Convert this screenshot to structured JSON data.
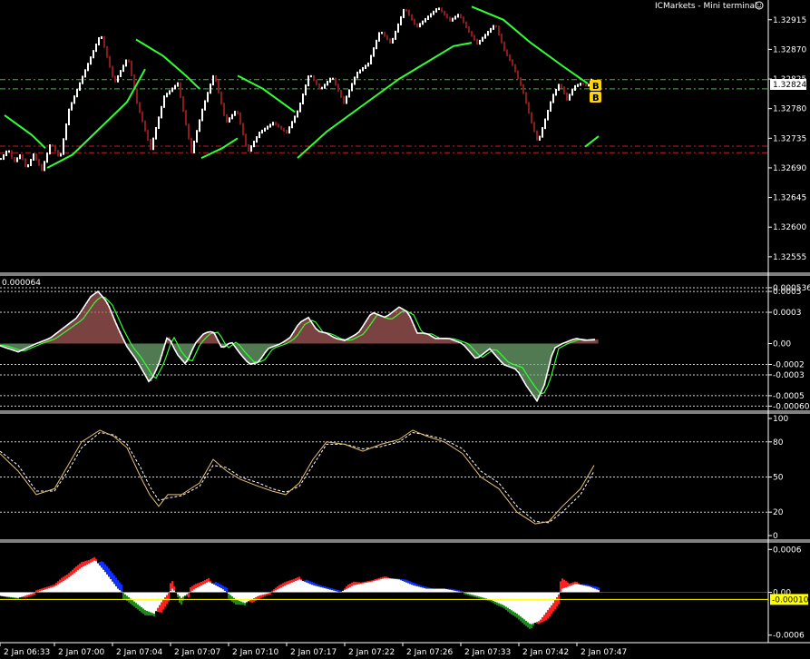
{
  "header": {
    "broker_label": "ICMarkets - Mini terminal",
    "icon": "smiley-icon"
  },
  "colors": {
    "background": "#000000",
    "grid": "#ffffff",
    "candle_up": "#ffffff",
    "candle_down": "#8b1a1a",
    "ma": "#32ff32",
    "level_green": "#2ec52e",
    "level_red": "#c02020",
    "badge": "#ffd700",
    "histogram_up": "#8b1a1a",
    "histogram_down": "#3a8a3a",
    "stoch_main": "#e8c070",
    "stoch_signal": "#ffffff",
    "p4_white": "#ffffff",
    "p4_red": "#ff2020",
    "p4_blue": "#1030ff",
    "p4_green": "#1a8a1a",
    "p4_line": "#ffff00"
  },
  "chart_data": [
    {
      "type": "line",
      "name": "price",
      "ylim": [
        1.3253,
        1.32945
      ],
      "yticks": [
        "1.32915",
        "1.32870",
        "1.32825",
        "1.32780",
        "1.32735",
        "1.32690",
        "1.32645",
        "1.32600",
        "1.32555"
      ],
      "current_price_label": "1.32824",
      "badges": [
        "B",
        "B"
      ],
      "levels": [
        {
          "value": 1.32824,
          "style": "dash-dot",
          "color": "level_green"
        },
        {
          "value": 1.3281,
          "style": "dash-dot",
          "color": "level_green"
        },
        {
          "value": 1.32723,
          "style": "dash-dot",
          "color": "level_red"
        },
        {
          "value": 1.32713,
          "style": "dash-dot",
          "color": "level_red"
        }
      ],
      "price_path": [
        [
          0,
          1.32705
        ],
        [
          8,
          1.3272
        ],
        [
          14,
          1.327
        ],
        [
          22,
          1.32712
        ],
        [
          28,
          1.3269
        ],
        [
          36,
          1.32712
        ],
        [
          45,
          1.32688
        ],
        [
          55,
          1.3273
        ],
        [
          65,
          1.32705
        ],
        [
          75,
          1.3278
        ],
        [
          90,
          1.3283
        ],
        [
          110,
          1.32895
        ],
        [
          125,
          1.3282
        ],
        [
          140,
          1.3286
        ],
        [
          150,
          1.3279
        ],
        [
          165,
          1.3272
        ],
        [
          180,
          1.328
        ],
        [
          195,
          1.3282
        ],
        [
          210,
          1.32715
        ],
        [
          222,
          1.3278
        ],
        [
          235,
          1.32835
        ],
        [
          248,
          1.3276
        ],
        [
          260,
          1.3278
        ],
        [
          272,
          1.32715
        ],
        [
          285,
          1.32745
        ],
        [
          300,
          1.3276
        ],
        [
          315,
          1.32745
        ],
        [
          328,
          1.3278
        ],
        [
          340,
          1.32835
        ],
        [
          352,
          1.3281
        ],
        [
          365,
          1.3283
        ],
        [
          378,
          1.3279
        ],
        [
          392,
          1.32835
        ],
        [
          405,
          1.3285
        ],
        [
          418,
          1.329
        ],
        [
          430,
          1.3288
        ],
        [
          445,
          1.32935
        ],
        [
          458,
          1.32905
        ],
        [
          470,
          1.3292
        ],
        [
          482,
          1.32935
        ],
        [
          495,
          1.32915
        ],
        [
          505,
          1.32925
        ],
        [
          515,
          1.329
        ],
        [
          525,
          1.3288
        ],
        [
          535,
          1.32895
        ],
        [
          545,
          1.3291
        ],
        [
          555,
          1.3287
        ],
        [
          565,
          1.32845
        ],
        [
          575,
          1.3281
        ],
        [
          585,
          1.3276
        ],
        [
          592,
          1.3273
        ],
        [
          600,
          1.32765
        ],
        [
          608,
          1.328
        ],
        [
          616,
          1.3282
        ],
        [
          624,
          1.32795
        ],
        [
          632,
          1.32815
        ],
        [
          640,
          1.3282
        ],
        [
          647,
          1.32815
        ],
        [
          652,
          1.32828
        ]
      ],
      "ma_segments": [
        [
          [
            5,
            1.3277
          ],
          [
            35,
            1.3274
          ],
          [
            50,
            1.3272
          ]
        ],
        [
          [
            52,
            1.3269
          ],
          [
            80,
            1.3271
          ],
          [
            110,
            1.3275
          ],
          [
            140,
            1.3279
          ],
          [
            160,
            1.3284
          ]
        ],
        [
          [
            150,
            1.32885
          ],
          [
            180,
            1.3286
          ],
          [
            205,
            1.3283
          ],
          [
            220,
            1.3281
          ]
        ],
        [
          [
            222,
            1.32705
          ],
          [
            245,
            1.3272
          ],
          [
            262,
            1.32735
          ]
        ],
        [
          [
            262,
            1.3283
          ],
          [
            290,
            1.3281
          ],
          [
            325,
            1.32775
          ]
        ],
        [
          [
            328,
            1.32705
          ],
          [
            360,
            1.32745
          ],
          [
            400,
            1.32785
          ],
          [
            440,
            1.32825
          ],
          [
            470,
            1.3285
          ],
          [
            500,
            1.32875
          ],
          [
            520,
            1.3288
          ]
        ],
        [
          [
            520,
            1.32935
          ],
          [
            555,
            1.32915
          ],
          [
            585,
            1.3288
          ],
          [
            620,
            1.32845
          ],
          [
            648,
            1.32818
          ]
        ],
        [
          [
            645,
            1.32722
          ],
          [
            660,
            1.32738
          ]
        ]
      ]
    },
    {
      "type": "bar",
      "name": "histogram_oscillator",
      "header_value": "0.000064",
      "ylim": [
        -0.00064,
        0.00064
      ],
      "yticks": [
        "0.000536",
        "0.0005",
        "0.0003",
        "0.00",
        "-0.0002",
        "-0.0003",
        "-0.0005",
        "-0.00060"
      ],
      "profile": [
        [
          0,
          -2e-05
        ],
        [
          20,
          -8e-05
        ],
        [
          40,
          0.0
        ],
        [
          55,
          5e-05
        ],
        [
          70,
          0.00015
        ],
        [
          85,
          0.00025
        ],
        [
          100,
          0.00045
        ],
        [
          108,
          0.0005
        ],
        [
          118,
          0.0004
        ],
        [
          130,
          0.00015
        ],
        [
          140,
          -3e-05
        ],
        [
          150,
          -0.00015
        ],
        [
          160,
          -0.0003
        ],
        [
          165,
          -0.00038
        ],
        [
          175,
          -0.0002
        ],
        [
          185,
          8e-05
        ],
        [
          195,
          -0.0001
        ],
        [
          205,
          -0.0002
        ],
        [
          215,
          0.0
        ],
        [
          225,
          0.0001
        ],
        [
          235,
          0.00012
        ],
        [
          245,
          -5e-05
        ],
        [
          255,
          2e-05
        ],
        [
          265,
          -0.0001
        ],
        [
          275,
          -0.0002
        ],
        [
          285,
          -0.00018
        ],
        [
          295,
          -5e-05
        ],
        [
          310,
          0.0
        ],
        [
          320,
          6e-05
        ],
        [
          330,
          0.0002
        ],
        [
          340,
          0.00025
        ],
        [
          350,
          0.00012
        ],
        [
          360,
          0.0001
        ],
        [
          370,
          5e-05
        ],
        [
          380,
          3e-05
        ],
        [
          395,
          0.0001
        ],
        [
          410,
          0.0003
        ],
        [
          425,
          0.00025
        ],
        [
          440,
          0.00035
        ],
        [
          450,
          0.0003
        ],
        [
          460,
          0.0001
        ],
        [
          470,
          0.0001
        ],
        [
          480,
          5e-05
        ],
        [
          495,
          5e-05
        ],
        [
          510,
          0.0
        ],
        [
          525,
          -0.00015
        ],
        [
          540,
          -5e-05
        ],
        [
          555,
          -0.0002
        ],
        [
          570,
          -0.00025
        ],
        [
          580,
          -0.0004
        ],
        [
          592,
          -0.00055
        ],
        [
          600,
          -0.0004
        ],
        [
          610,
          -5e-05
        ],
        [
          620,
          0.0
        ],
        [
          635,
          5e-05
        ],
        [
          645,
          3e-05
        ],
        [
          655,
          4e-05
        ]
      ]
    },
    {
      "type": "line",
      "name": "stochastic",
      "ylim": [
        0,
        100
      ],
      "yticks": [
        "100",
        "80",
        "50",
        "20",
        "0"
      ],
      "levels": [
        80,
        50,
        20
      ],
      "main": [
        [
          0,
          70
        ],
        [
          20,
          55
        ],
        [
          40,
          35
        ],
        [
          60,
          40
        ],
        [
          75,
          60
        ],
        [
          90,
          80
        ],
        [
          110,
          90
        ],
        [
          125,
          85
        ],
        [
          140,
          75
        ],
        [
          155,
          50
        ],
        [
          165,
          35
        ],
        [
          175,
          25
        ],
        [
          185,
          35
        ],
        [
          200,
          35
        ],
        [
          220,
          45
        ],
        [
          235,
          65
        ],
        [
          250,
          55
        ],
        [
          265,
          48
        ],
        [
          285,
          42
        ],
        [
          300,
          38
        ],
        [
          315,
          35
        ],
        [
          330,
          45
        ],
        [
          345,
          65
        ],
        [
          360,
          80
        ],
        [
          380,
          78
        ],
        [
          400,
          72
        ],
        [
          420,
          78
        ],
        [
          440,
          82
        ],
        [
          455,
          90
        ],
        [
          470,
          85
        ],
        [
          490,
          80
        ],
        [
          510,
          70
        ],
        [
          530,
          50
        ],
        [
          550,
          40
        ],
        [
          570,
          20
        ],
        [
          590,
          10
        ],
        [
          605,
          12
        ],
        [
          620,
          25
        ],
        [
          640,
          40
        ],
        [
          655,
          60
        ]
      ],
      "signal": [
        [
          0,
          72
        ],
        [
          20,
          60
        ],
        [
          40,
          38
        ],
        [
          60,
          38
        ],
        [
          75,
          55
        ],
        [
          90,
          75
        ],
        [
          110,
          88
        ],
        [
          125,
          86
        ],
        [
          140,
          78
        ],
        [
          155,
          58
        ],
        [
          165,
          42
        ],
        [
          175,
          30
        ],
        [
          185,
          32
        ],
        [
          200,
          34
        ],
        [
          220,
          42
        ],
        [
          235,
          60
        ],
        [
          250,
          58
        ],
        [
          265,
          50
        ],
        [
          285,
          45
        ],
        [
          300,
          40
        ],
        [
          315,
          37
        ],
        [
          330,
          42
        ],
        [
          345,
          60
        ],
        [
          360,
          78
        ],
        [
          380,
          78
        ],
        [
          400,
          74
        ],
        [
          420,
          76
        ],
        [
          440,
          80
        ],
        [
          455,
          88
        ],
        [
          470,
          86
        ],
        [
          490,
          82
        ],
        [
          510,
          74
        ],
        [
          530,
          55
        ],
        [
          550,
          45
        ],
        [
          570,
          25
        ],
        [
          590,
          12
        ],
        [
          605,
          11
        ],
        [
          620,
          20
        ],
        [
          640,
          35
        ],
        [
          655,
          55
        ]
      ]
    },
    {
      "type": "area",
      "name": "composite_histogram",
      "ylim": [
        -0.00068,
        0.00068
      ],
      "yticks": [
        "0.0006",
        "0.00",
        "-0.00010",
        "-0.0006"
      ],
      "signal_line": -0.0001,
      "signal_label": "-0.00010",
      "profile": [
        [
          0,
          -5e-05
        ],
        [
          20,
          -8e-05
        ],
        [
          40,
          0.0
        ],
        [
          60,
          8e-05
        ],
        [
          75,
          0.0002
        ],
        [
          90,
          0.00035
        ],
        [
          105,
          0.00045
        ],
        [
          115,
          0.0003
        ],
        [
          130,
          5e-05
        ],
        [
          145,
          -0.0001
        ],
        [
          160,
          -0.00025
        ],
        [
          170,
          -0.0003
        ],
        [
          180,
          -0.0001
        ],
        [
          190,
          5e-05
        ],
        [
          200,
          -8e-05
        ],
        [
          215,
          5e-05
        ],
        [
          230,
          0.00015
        ],
        [
          245,
          5e-05
        ],
        [
          260,
          -0.0001
        ],
        [
          270,
          -0.00015
        ],
        [
          285,
          -5e-05
        ],
        [
          300,
          0.0
        ],
        [
          315,
          0.0001
        ],
        [
          330,
          0.00018
        ],
        [
          345,
          0.0001
        ],
        [
          360,
          5e-05
        ],
        [
          375,
          0.0
        ],
        [
          390,
          0.0001
        ],
        [
          410,
          0.00015
        ],
        [
          425,
          0.0002
        ],
        [
          440,
          0.00018
        ],
        [
          455,
          0.0001
        ],
        [
          470,
          5e-05
        ],
        [
          490,
          5e-05
        ],
        [
          510,
          0.0
        ],
        [
          525,
          -5e-05
        ],
        [
          540,
          -0.0001
        ],
        [
          555,
          -0.00018
        ],
        [
          570,
          -0.0003
        ],
        [
          585,
          -0.00045
        ],
        [
          595,
          -0.0004
        ],
        [
          610,
          -0.00015
        ],
        [
          620,
          5e-05
        ],
        [
          635,
          0.00012
        ],
        [
          650,
          8e-05
        ],
        [
          660,
          3e-05
        ]
      ]
    }
  ],
  "x_axis": {
    "labels": [
      "2 Jan 06:33",
      "2 Jan 07:00",
      "2 Jan 07:04",
      "2 Jan 07:07",
      "2 Jan 07:10",
      "2 Jan 07:17",
      "2 Jan 07:22",
      "2 Jan 07:26",
      "2 Jan 07:33",
      "2 Jan 07:42",
      "2 Jan 07:47"
    ]
  }
}
